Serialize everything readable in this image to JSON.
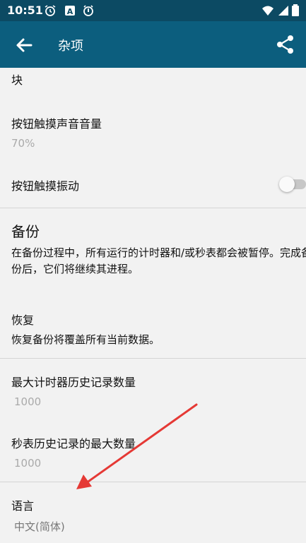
{
  "status_bar": {
    "time": "10:51",
    "icons": [
      "alarm-clock-icon",
      "a-box-icon",
      "stopwatch-alarm-icon",
      "wifi-icon",
      "battery-icon"
    ]
  },
  "app_bar": {
    "title": "杂项",
    "color": "#0c5e7e",
    "back_icon": "arrow-left-icon",
    "share_icon": "share-icon"
  },
  "settings": {
    "partial_top_label": "块",
    "button_sound": {
      "title": "按钮触摸声音音量",
      "value": "70%"
    },
    "button_vibrate": {
      "title": "按钮触摸振动",
      "enabled": false
    },
    "backup": {
      "title": "备份",
      "description": "在备份过程中，所有运行的计时器和/或秒表都会被暂停。完成备份后，它们将继续其进程。"
    },
    "restore": {
      "title": "恢复",
      "description": "恢复备份将覆盖所有当前数据。"
    },
    "max_timer_history": {
      "title": "最大计时器历史记录数量",
      "value": "1000"
    },
    "max_stopwatch_history": {
      "title": "秒表历史记录的最大数量",
      "value": "1000"
    },
    "language": {
      "title": "语言",
      "value": "中文(简体)"
    }
  },
  "annotation": {
    "color": "#e53935"
  }
}
